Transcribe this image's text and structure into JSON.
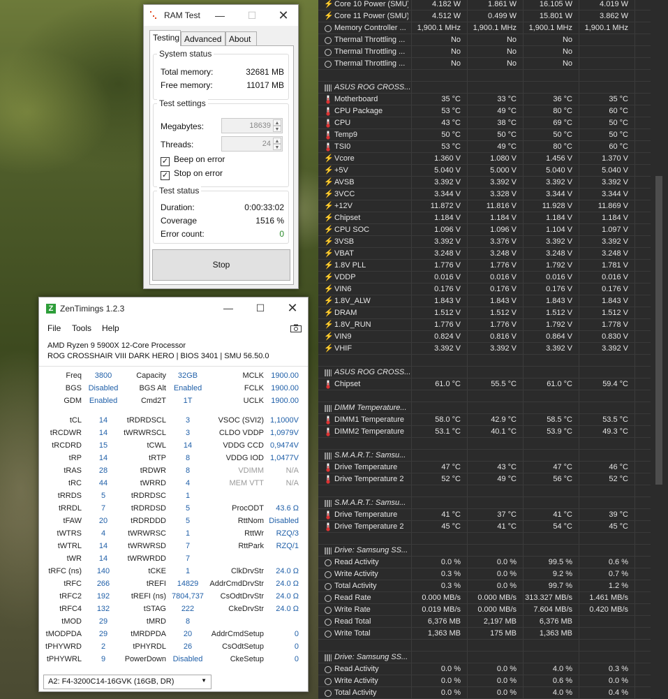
{
  "hwinfo": {
    "rows": [
      {
        "icon": "bolt",
        "label": "Core 10 Power (SMU)",
        "values": [
          "4.182 W",
          "1.861 W",
          "16.105 W",
          "4.019 W"
        ]
      },
      {
        "icon": "bolt",
        "label": "Core 11 Power (SMU)",
        "values": [
          "4.512 W",
          "0.499 W",
          "15.801 W",
          "3.862 W"
        ]
      },
      {
        "icon": "circle",
        "label": "Memory Controller ...",
        "values": [
          "1,900.1 MHz",
          "1,900.1 MHz",
          "1,900.1 MHz",
          "1,900.1 MHz"
        ]
      },
      {
        "icon": "circle",
        "label": "Thermal Throttling ...",
        "values": [
          "No",
          "No",
          "No",
          ""
        ]
      },
      {
        "icon": "circle",
        "label": "Thermal Throttling ...",
        "values": [
          "No",
          "No",
          "No",
          ""
        ]
      },
      {
        "icon": "circle",
        "label": "Thermal Throttling ...",
        "values": [
          "No",
          "No",
          "No",
          ""
        ]
      },
      {
        "icon": "blank",
        "label": "",
        "values": [
          "",
          "",
          "",
          ""
        ]
      },
      {
        "icon": "group",
        "label": "ASUS ROG CROSS...",
        "values": [
          "",
          "",
          "",
          ""
        ]
      },
      {
        "icon": "therm",
        "label": "Motherboard",
        "values": [
          "35 °C",
          "33 °C",
          "36 °C",
          "35 °C"
        ]
      },
      {
        "icon": "therm",
        "label": "CPU Package",
        "values": [
          "53 °C",
          "49 °C",
          "80 °C",
          "60 °C"
        ]
      },
      {
        "icon": "therm",
        "label": "CPU",
        "values": [
          "43 °C",
          "38 °C",
          "69 °C",
          "50 °C"
        ]
      },
      {
        "icon": "therm",
        "label": "Temp9",
        "values": [
          "50 °C",
          "50 °C",
          "50 °C",
          "50 °C"
        ]
      },
      {
        "icon": "therm",
        "label": "TSI0",
        "values": [
          "53 °C",
          "49 °C",
          "80 °C",
          "60 °C"
        ]
      },
      {
        "icon": "bolt",
        "label": "Vcore",
        "values": [
          "1.360 V",
          "1.080 V",
          "1.456 V",
          "1.370 V"
        ]
      },
      {
        "icon": "bolt",
        "label": "+5V",
        "values": [
          "5.040 V",
          "5.000 V",
          "5.040 V",
          "5.040 V"
        ]
      },
      {
        "icon": "bolt",
        "label": "AVSB",
        "values": [
          "3.392 V",
          "3.392 V",
          "3.392 V",
          "3.392 V"
        ]
      },
      {
        "icon": "bolt",
        "label": "3VCC",
        "values": [
          "3.344 V",
          "3.328 V",
          "3.344 V",
          "3.344 V"
        ]
      },
      {
        "icon": "bolt",
        "label": "+12V",
        "values": [
          "11.872 V",
          "11.816 V",
          "11.928 V",
          "11.869 V"
        ]
      },
      {
        "icon": "bolt",
        "label": "Chipset",
        "values": [
          "1.184 V",
          "1.184 V",
          "1.184 V",
          "1.184 V"
        ]
      },
      {
        "icon": "bolt",
        "label": "CPU SOC",
        "values": [
          "1.096 V",
          "1.096 V",
          "1.104 V",
          "1.097 V"
        ]
      },
      {
        "icon": "bolt",
        "label": "3VSB",
        "values": [
          "3.392 V",
          "3.376 V",
          "3.392 V",
          "3.392 V"
        ]
      },
      {
        "icon": "bolt",
        "label": "VBAT",
        "values": [
          "3.248 V",
          "3.248 V",
          "3.248 V",
          "3.248 V"
        ]
      },
      {
        "icon": "bolt",
        "label": "1.8V PLL",
        "values": [
          "1.776 V",
          "1.776 V",
          "1.792 V",
          "1.781 V"
        ]
      },
      {
        "icon": "bolt",
        "label": "VDDP",
        "values": [
          "0.016 V",
          "0.016 V",
          "0.016 V",
          "0.016 V"
        ]
      },
      {
        "icon": "bolt",
        "label": "VIN6",
        "values": [
          "0.176 V",
          "0.176 V",
          "0.176 V",
          "0.176 V"
        ]
      },
      {
        "icon": "bolt",
        "label": "1.8V_ALW",
        "values": [
          "1.843 V",
          "1.843 V",
          "1.843 V",
          "1.843 V"
        ]
      },
      {
        "icon": "bolt",
        "label": "DRAM",
        "values": [
          "1.512 V",
          "1.512 V",
          "1.512 V",
          "1.512 V"
        ]
      },
      {
        "icon": "bolt",
        "label": "1.8V_RUN",
        "values": [
          "1.776 V",
          "1.776 V",
          "1.792 V",
          "1.778 V"
        ]
      },
      {
        "icon": "bolt",
        "label": "VIN9",
        "values": [
          "0.824 V",
          "0.816 V",
          "0.864 V",
          "0.830 V"
        ]
      },
      {
        "icon": "bolt",
        "label": "VHIF",
        "values": [
          "3.392 V",
          "3.392 V",
          "3.392 V",
          "3.392 V"
        ]
      },
      {
        "icon": "blank",
        "label": "",
        "values": [
          "",
          "",
          "",
          ""
        ]
      },
      {
        "icon": "group",
        "label": "ASUS ROG CROSS...",
        "values": [
          "",
          "",
          "",
          ""
        ]
      },
      {
        "icon": "therm",
        "label": "Chipset",
        "values": [
          "61.0 °C",
          "55.5 °C",
          "61.0 °C",
          "59.4 °C"
        ]
      },
      {
        "icon": "blank",
        "label": "",
        "values": [
          "",
          "",
          "",
          ""
        ]
      },
      {
        "icon": "group",
        "label": "DIMM Temperature...",
        "values": [
          "",
          "",
          "",
          ""
        ]
      },
      {
        "icon": "therm",
        "label": "DIMM1 Temperature",
        "values": [
          "58.0 °C",
          "42.9 °C",
          "58.5 °C",
          "53.5 °C"
        ]
      },
      {
        "icon": "therm",
        "label": "DIMM2 Temperature",
        "values": [
          "53.1 °C",
          "40.1 °C",
          "53.9 °C",
          "49.3 °C"
        ]
      },
      {
        "icon": "blank",
        "label": "",
        "values": [
          "",
          "",
          "",
          ""
        ]
      },
      {
        "icon": "group",
        "label": "S.M.A.R.T.: Samsu...",
        "values": [
          "",
          "",
          "",
          ""
        ]
      },
      {
        "icon": "therm",
        "label": "Drive Temperature",
        "values": [
          "47 °C",
          "43 °C",
          "47 °C",
          "46 °C"
        ]
      },
      {
        "icon": "therm",
        "label": "Drive Temperature 2",
        "values": [
          "52 °C",
          "49 °C",
          "56 °C",
          "52 °C"
        ]
      },
      {
        "icon": "blank",
        "label": "",
        "values": [
          "",
          "",
          "",
          ""
        ]
      },
      {
        "icon": "group",
        "label": "S.M.A.R.T.: Samsu...",
        "values": [
          "",
          "",
          "",
          ""
        ]
      },
      {
        "icon": "therm",
        "label": "Drive Temperature",
        "values": [
          "41 °C",
          "37 °C",
          "41 °C",
          "39 °C"
        ]
      },
      {
        "icon": "therm",
        "label": "Drive Temperature 2",
        "values": [
          "45 °C",
          "41 °C",
          "54 °C",
          "45 °C"
        ]
      },
      {
        "icon": "blank",
        "label": "",
        "values": [
          "",
          "",
          "",
          ""
        ]
      },
      {
        "icon": "group",
        "label": "Drive: Samsung SS...",
        "values": [
          "",
          "",
          "",
          ""
        ]
      },
      {
        "icon": "circle",
        "label": "Read Activity",
        "values": [
          "0.0 %",
          "0.0 %",
          "99.5 %",
          "0.6 %"
        ]
      },
      {
        "icon": "circle",
        "label": "Write Activity",
        "values": [
          "0.3 %",
          "0.0 %",
          "9.2 %",
          "0.7 %"
        ]
      },
      {
        "icon": "circle",
        "label": "Total Activity",
        "values": [
          "0.3 %",
          "0.0 %",
          "99.7 %",
          "1.2 %"
        ]
      },
      {
        "icon": "circle",
        "label": "Read Rate",
        "values": [
          "0.000 MB/s",
          "0.000 MB/s",
          "313.327 MB/s",
          "1.461 MB/s"
        ]
      },
      {
        "icon": "circle",
        "label": "Write Rate",
        "values": [
          "0.019 MB/s",
          "0.000 MB/s",
          "7.604 MB/s",
          "0.420 MB/s"
        ]
      },
      {
        "icon": "circle",
        "label": "Read Total",
        "values": [
          "6,376 MB",
          "2,197 MB",
          "6,376 MB",
          ""
        ]
      },
      {
        "icon": "circle",
        "label": "Write Total",
        "values": [
          "1,363 MB",
          "175 MB",
          "1,363 MB",
          ""
        ]
      },
      {
        "icon": "blank",
        "label": "",
        "values": [
          "",
          "",
          "",
          ""
        ]
      },
      {
        "icon": "group",
        "label": "Drive: Samsung SS...",
        "values": [
          "",
          "",
          "",
          ""
        ]
      },
      {
        "icon": "circle",
        "label": "Read Activity",
        "values": [
          "0.0 %",
          "0.0 %",
          "4.0 %",
          "0.3 %"
        ]
      },
      {
        "icon": "circle",
        "label": "Write Activity",
        "values": [
          "0.0 %",
          "0.0 %",
          "0.6 %",
          "0.0 %"
        ]
      },
      {
        "icon": "circle",
        "label": "Total Activity",
        "values": [
          "0.0 %",
          "0.0 %",
          "4.0 %",
          "0.4 %"
        ]
      }
    ]
  },
  "ramtest": {
    "title": "RAM Test",
    "tabs": [
      "Testing",
      "Advanced",
      "About"
    ],
    "system_status": {
      "title": "System status",
      "total_label": "Total memory:",
      "total_value": "32681 MB",
      "free_label": "Free memory:",
      "free_value": "11017 MB"
    },
    "test_settings": {
      "title": "Test settings",
      "megabytes_label": "Megabytes:",
      "megabytes_value": "18639",
      "threads_label": "Threads:",
      "threads_value": "24",
      "beep_label": "Beep on error",
      "stop_label": "Stop on error"
    },
    "test_status": {
      "title": "Test status",
      "duration_label": "Duration:",
      "duration_value": "0:00:33:02",
      "coverage_label": "Coverage",
      "coverage_value": "1516 %",
      "errors_label": "Error count:",
      "errors_value": "0"
    },
    "stop_button": "Stop",
    "colors": {
      "error_count": "#2a8a2a"
    }
  },
  "zentimings": {
    "title": "ZenTimings 1.2.3",
    "menu": [
      "File",
      "Tools",
      "Help"
    ],
    "cpu": "AMD Ryzen 9 5900X 12-Core Processor",
    "board": "ROG CROSSHAIR VIII DARK HERO | BIOS 3401 | SMU 56.50.0",
    "top": [
      [
        "Freq",
        "3800",
        "Capacity",
        "32GB",
        "MCLK",
        "1900.00"
      ],
      [
        "BGS",
        "Disabled",
        "BGS Alt",
        "Enabled",
        "FCLK",
        "1900.00"
      ],
      [
        "GDM",
        "Enabled",
        "Cmd2T",
        "1T",
        "UCLK",
        "1900.00"
      ]
    ],
    "timings": [
      [
        "tCL",
        "14",
        "tRDRDSCL",
        "3",
        "VSOC (SVI2)",
        "1,1000V"
      ],
      [
        "tRCDWR",
        "14",
        "tWRWRSCL",
        "3",
        "CLDO VDDP",
        "1,0979V"
      ],
      [
        "tRCDRD",
        "15",
        "tCWL",
        "14",
        "VDDG CCD",
        "0,9474V"
      ],
      [
        "tRP",
        "14",
        "tRTP",
        "8",
        "VDDG IOD",
        "1,0477V"
      ],
      [
        "tRAS",
        "28",
        "tRDWR",
        "8",
        "VDIMM",
        "N/A"
      ],
      [
        "tRC",
        "44",
        "tWRRD",
        "4",
        "MEM VTT",
        "N/A"
      ],
      [
        "tRRDS",
        "5",
        "tRDRDSC",
        "1",
        "",
        ""
      ],
      [
        "tRRDL",
        "7",
        "tRDRDSD",
        "5",
        "ProcODT",
        "43.6 Ω"
      ],
      [
        "tFAW",
        "20",
        "tRDRDDD",
        "5",
        "RttNom",
        "Disabled"
      ],
      [
        "tWTRS",
        "4",
        "tWRWRSC",
        "1",
        "RttWr",
        "RZQ/3"
      ],
      [
        "tWTRL",
        "14",
        "tWRWRSD",
        "7",
        "RttPark",
        "RZQ/1"
      ],
      [
        "tWR",
        "14",
        "tWRWRDD",
        "7",
        "",
        ""
      ],
      [
        "tRFC (ns)",
        "140",
        "tCKE",
        "1",
        "ClkDrvStr",
        "24.0 Ω"
      ],
      [
        "tRFC",
        "266",
        "tREFI",
        "14829",
        "AddrCmdDrvStr",
        "24.0 Ω"
      ],
      [
        "tRFC2",
        "192",
        "tREFI (ns)",
        "7804,737",
        "CsOdtDrvStr",
        "24.0 Ω"
      ],
      [
        "tRFC4",
        "132",
        "tSTAG",
        "222",
        "CkeDrvStr",
        "24.0 Ω"
      ],
      [
        "tMOD",
        "29",
        "tMRD",
        "8",
        "",
        ""
      ],
      [
        "tMODPDA",
        "29",
        "tMRDPDA",
        "20",
        "AddrCmdSetup",
        "0"
      ],
      [
        "tPHYWRD",
        "2",
        "tPHYRDL",
        "26",
        "CsOdtSetup",
        "0"
      ],
      [
        "tPHYWRL",
        "9",
        "PowerDown",
        "Disabled",
        "CkeSetup",
        "0"
      ]
    ],
    "dimm_select": "A2: F4-3200C14-16GVK (16GB, DR)",
    "colors": {
      "value": "#1f5fa8",
      "disabled": "#9a9a9a"
    }
  }
}
